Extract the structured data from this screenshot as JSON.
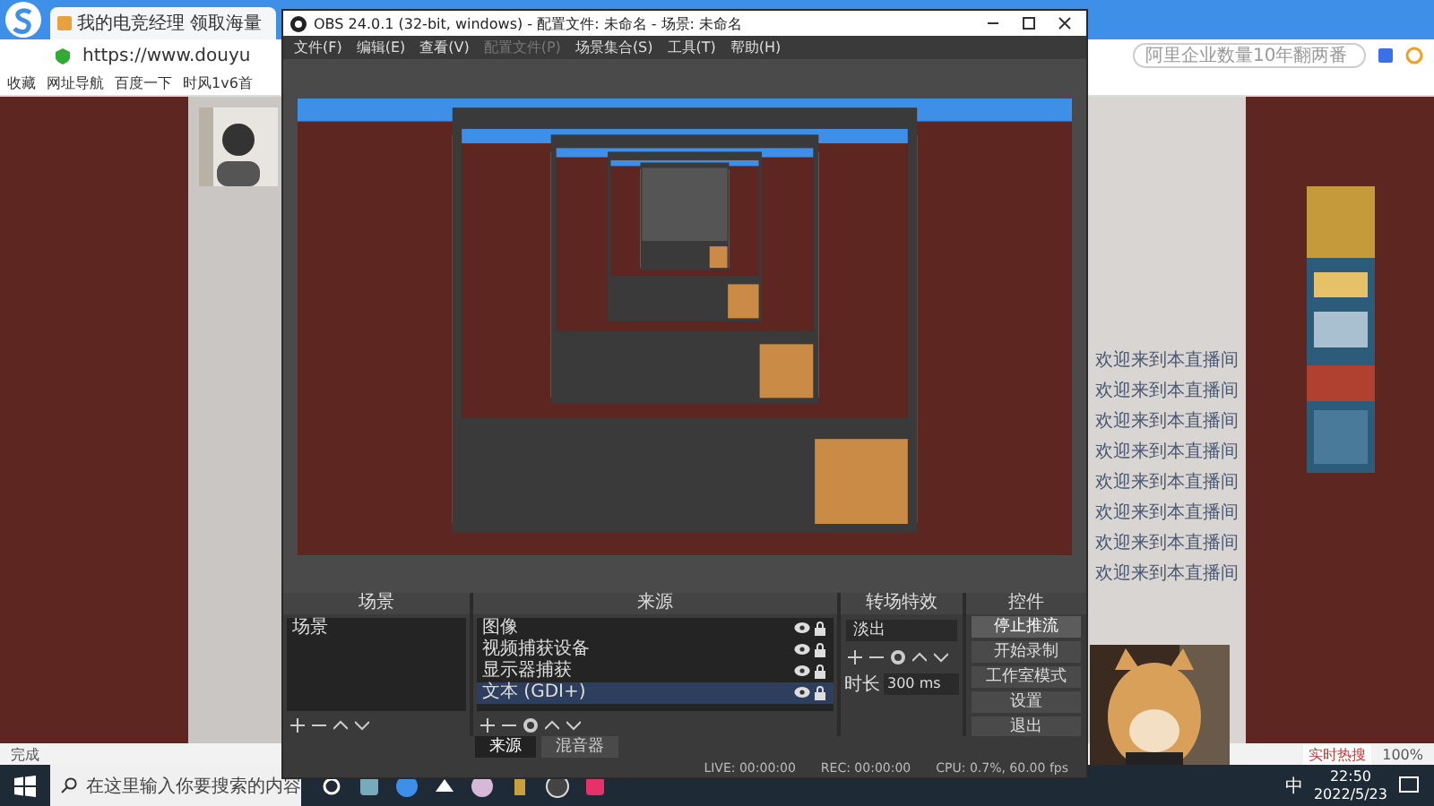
{
  "browser": {
    "tab_title": "我的电竞经理 领取海量",
    "url": "https://www.douyu",
    "bookmarks": [
      "收藏",
      "网址导航",
      "百度一下",
      "时风1v6首"
    ],
    "search_placeholder": "阿里企业数量10年翻两番",
    "chat_lines": [
      "欢迎来到本直播间",
      "欢迎来到本直播间",
      "欢迎来到本直播间",
      "欢迎来到本直播间",
      "欢迎来到本直播间",
      "欢迎来到本直播间",
      "欢迎来到本直播间",
      "欢迎来到本直播间"
    ],
    "status_text": "完成",
    "hot_search": "实时热搜",
    "zoom": "100%"
  },
  "obs": {
    "title": "OBS 24.0.1 (32-bit, windows) - 配置文件: 未命名 - 场景: 未命名",
    "menu": [
      {
        "label": "文件(F)",
        "disabled": false
      },
      {
        "label": "编辑(E)",
        "disabled": false
      },
      {
        "label": "查看(V)",
        "disabled": false
      },
      {
        "label": "配置文件(P)",
        "disabled": true
      },
      {
        "label": "场景集合(S)",
        "disabled": false
      },
      {
        "label": "工具(T)",
        "disabled": false
      },
      {
        "label": "帮助(H)",
        "disabled": false
      }
    ],
    "scenes_dock": {
      "title": "场景",
      "items": [
        {
          "label": "场景",
          "selected": false
        }
      ]
    },
    "sources_dock": {
      "title": "来源",
      "items": [
        {
          "label": "图像",
          "selected": false
        },
        {
          "label": "视频捕获设备",
          "selected": false
        },
        {
          "label": "显示器捕获",
          "selected": false
        },
        {
          "label": "文本 (GDI+)",
          "selected": true
        }
      ]
    },
    "transitions_dock": {
      "title": "转场特效",
      "transition": "淡出",
      "duration_label": "时长",
      "duration": "300 ms"
    },
    "controls_dock": {
      "title": "控件",
      "buttons": [
        {
          "label": "停止推流",
          "active": true
        },
        {
          "label": "开始录制",
          "active": false
        },
        {
          "label": "工作室模式",
          "active": false
        },
        {
          "label": "设置",
          "active": false
        },
        {
          "label": "退出",
          "active": false
        }
      ]
    },
    "dock_tabs": [
      {
        "label": "来源",
        "selected": true
      },
      {
        "label": "混音器",
        "selected": false
      }
    ],
    "status": {
      "live": "LIVE: 00:00:00",
      "rec": "REC: 00:00:00",
      "cpu": "CPU: 0.7%, 60.00 fps"
    }
  },
  "taskbar": {
    "search_placeholder": "在这里输入你要搜索的内容",
    "ime": "中",
    "time": "22:50",
    "date": "2022/5/23"
  }
}
